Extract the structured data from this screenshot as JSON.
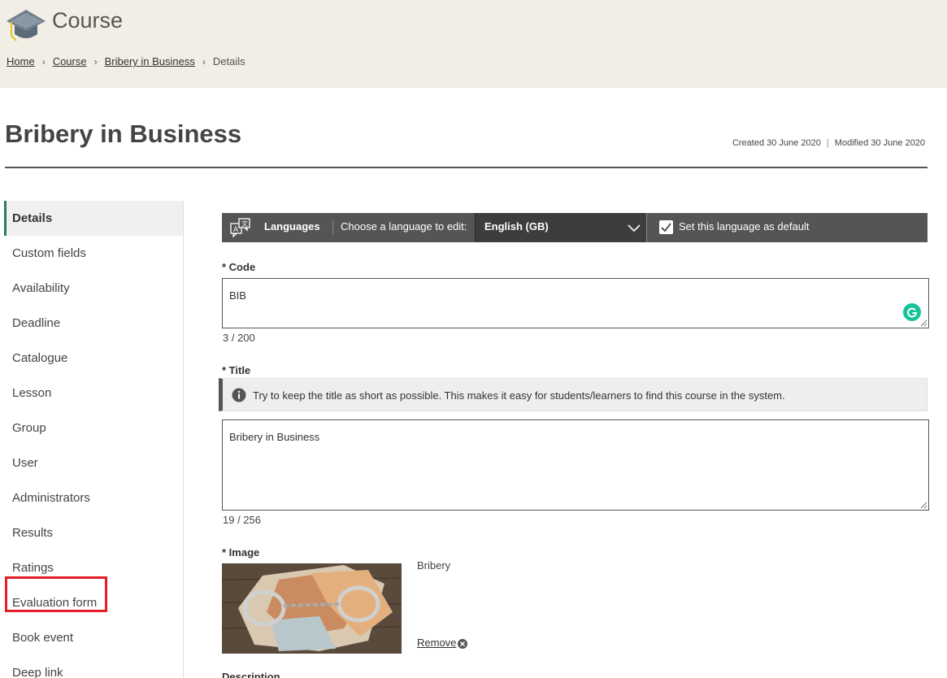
{
  "header": {
    "course_heading": "Course",
    "breadcrumb": {
      "home": "Home",
      "course": "Course",
      "item": "Bribery in Business",
      "current": "Details",
      "separator": "›"
    }
  },
  "page": {
    "title": "Bribery in Business",
    "created": "Created 30 June 2020",
    "pipe": "|",
    "modified": "Modified 30 June 2020"
  },
  "sidebar": {
    "items": [
      {
        "label": "Details"
      },
      {
        "label": "Custom fields"
      },
      {
        "label": "Availability"
      },
      {
        "label": "Deadline"
      },
      {
        "label": "Catalogue"
      },
      {
        "label": "Lesson"
      },
      {
        "label": "Group"
      },
      {
        "label": "User"
      },
      {
        "label": "Administrators"
      },
      {
        "label": "Results"
      },
      {
        "label": "Ratings"
      },
      {
        "label": "Evaluation form"
      },
      {
        "label": "Book event"
      },
      {
        "label": "Deep link"
      }
    ]
  },
  "languages": {
    "label": "Languages",
    "choose": "Choose a language to edit:",
    "selected": "English (GB)",
    "set_default": "Set this language as default",
    "icon": "translate-icon"
  },
  "form": {
    "code": {
      "label": "* Code",
      "value": "BIB",
      "counter": "3 / 200"
    },
    "title": {
      "label": "* Title",
      "info": "Try to keep the title as short as possible. This makes it easy for students/learners to find this course in the system.",
      "value": "Bribery in Business",
      "counter": "19 / 256"
    },
    "image": {
      "label": "* Image",
      "name": "Bribery",
      "remove": "Remove"
    },
    "description": {
      "label": "Description"
    }
  },
  "colors": {
    "header_bg": "#f0eee5",
    "langbar_bg": "#555555",
    "active_accent": "#2e7d5b",
    "highlight_box": "#e51e25",
    "grammarly": "#15c39a"
  }
}
